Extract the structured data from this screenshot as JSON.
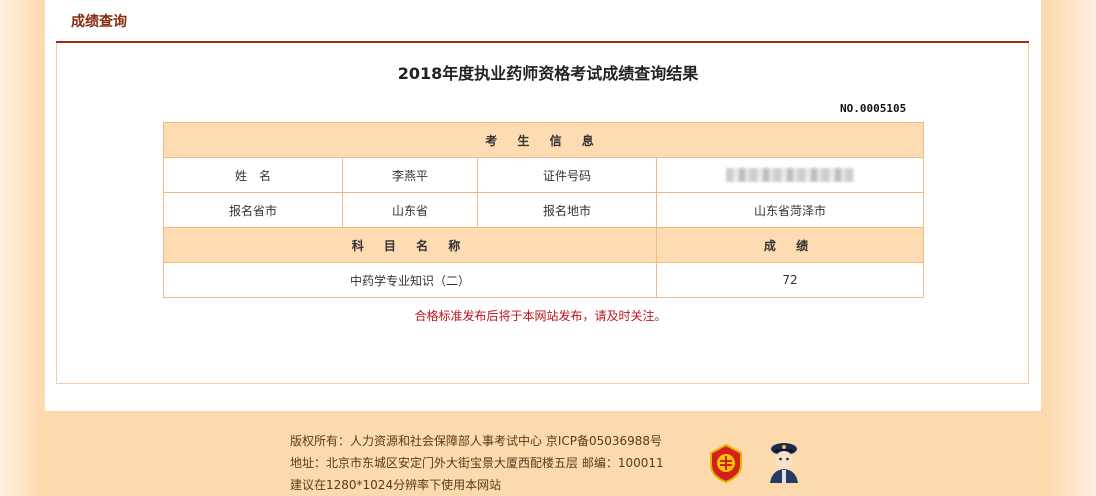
{
  "header": {
    "title": "成绩查询"
  },
  "result": {
    "title": "2018年度执业药师资格考试成绩查询结果",
    "serial": "NO.0005105"
  },
  "table": {
    "section_candidate": "考 生 信 息",
    "name_label": "姓　名",
    "name_value": "李燕平",
    "id_label": "证件号码",
    "province_label": "报名省市",
    "province_value": "山东省",
    "city_label": "报名地市",
    "city_value": "山东省菏泽市",
    "subject_header": "科 目 名 称",
    "score_header": "成 绩",
    "rows": [
      {
        "subject": "中药学专业知识（二）",
        "score": "72"
      }
    ]
  },
  "notice": "合格标准发布后将于本网站发布，请及时关注。",
  "footer": {
    "copyright": "版权所有：人力资源和社会保障部人事考试中心 京ICP备05036988号",
    "address": "地址：北京市东城区安定门外大街宝景大厦西配楼五层 邮编：100011",
    "resolution": "建议在1280*1024分辨率下使用本网站"
  },
  "colors": {
    "accent": "#a8281a",
    "header_text": "#8a2a0e",
    "table_header_bg": "#fddcb4",
    "table_border": "#f0b98a",
    "notice": "#c0141b"
  },
  "icons": [
    "emblem-icon",
    "police-icon"
  ]
}
